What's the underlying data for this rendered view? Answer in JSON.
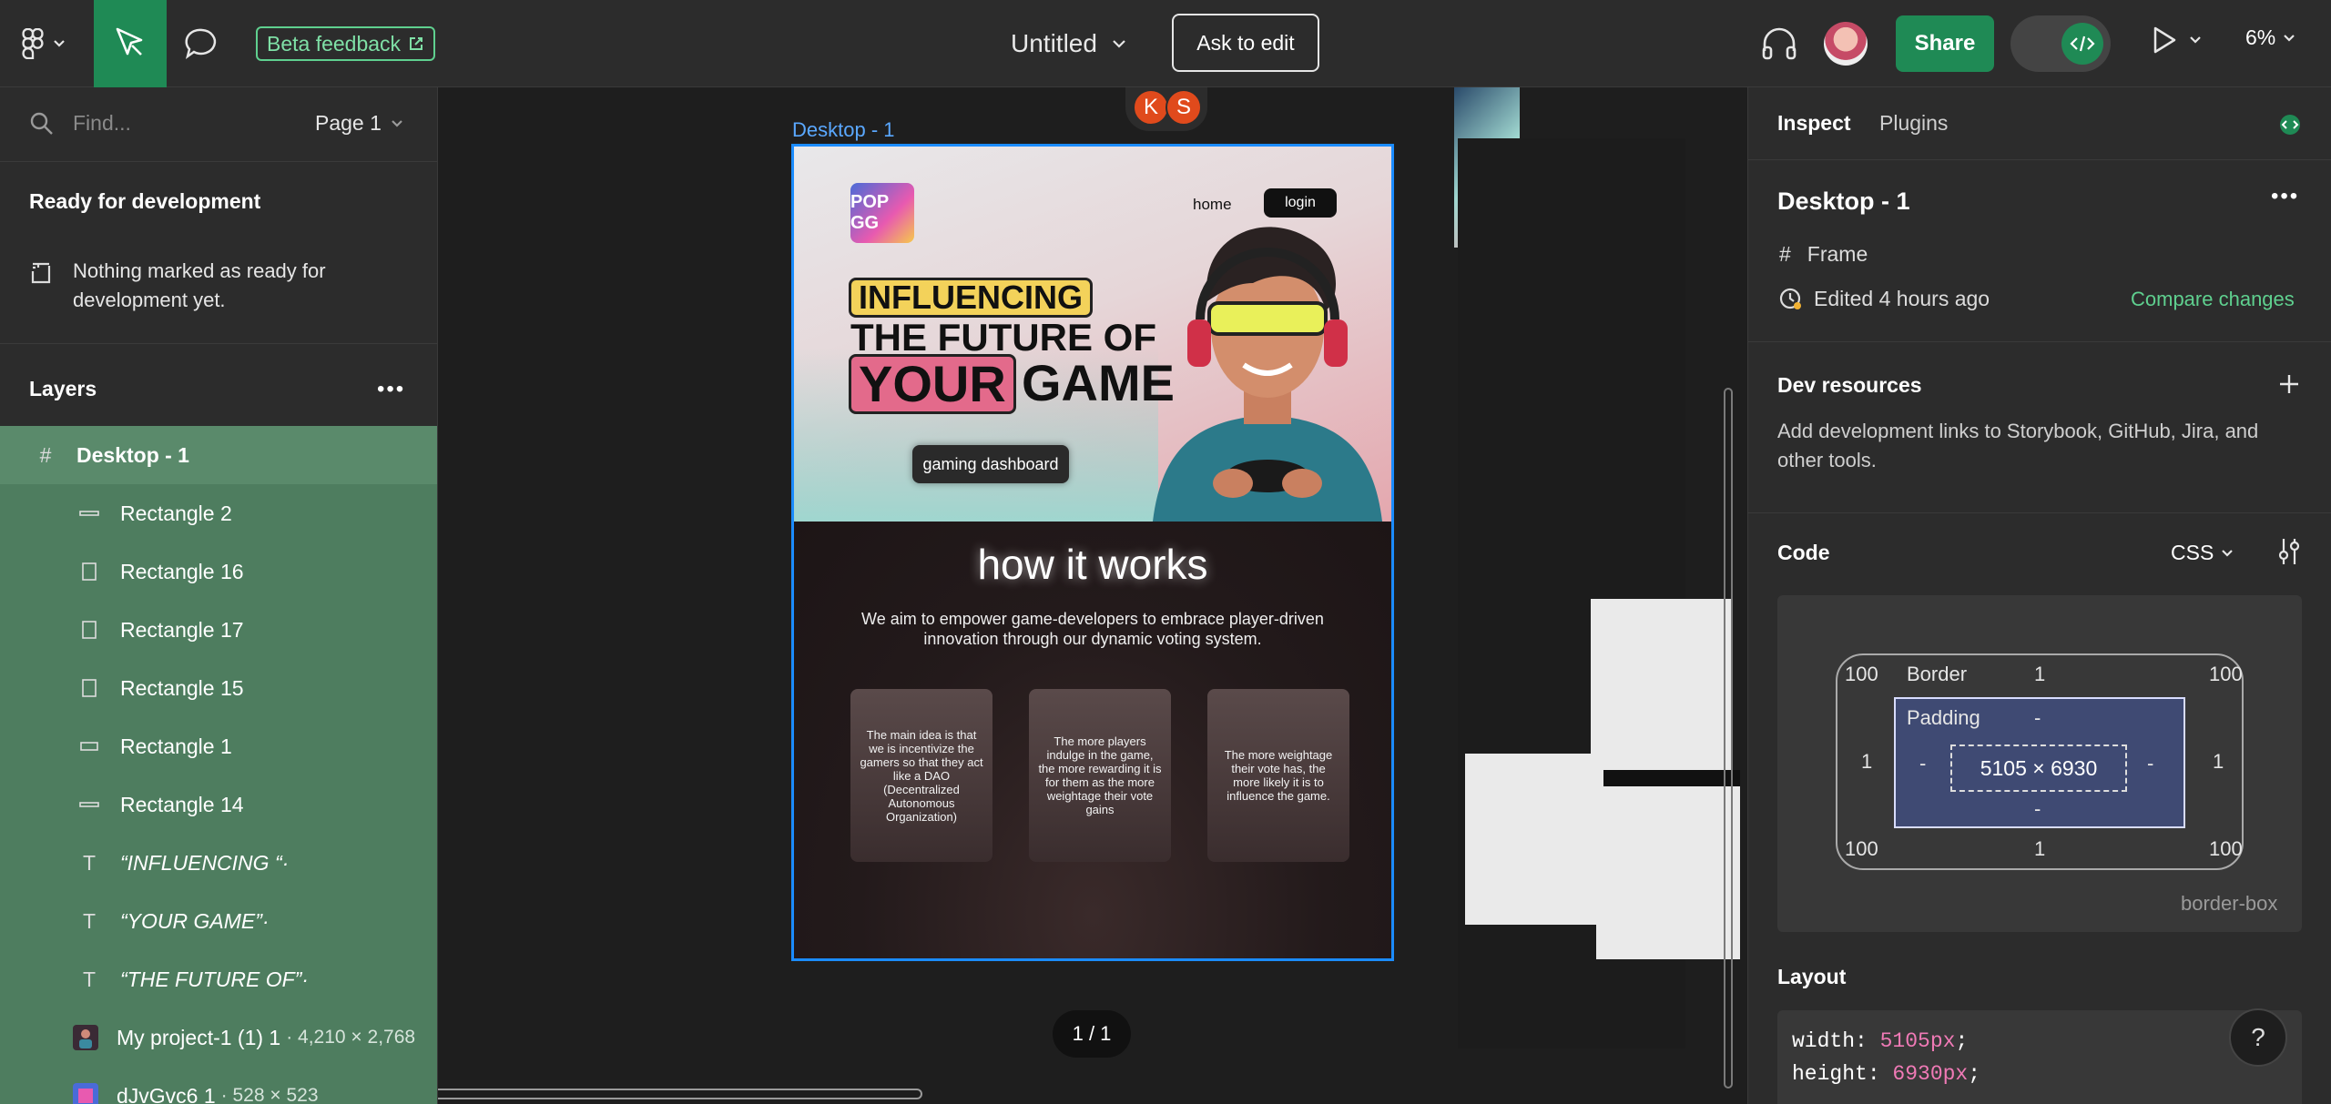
{
  "topbar": {
    "beta_label": "Beta feedback",
    "file_title": "Untitled",
    "ask_label": "Ask to edit",
    "share_label": "Share",
    "zoom": "6%"
  },
  "left": {
    "find_placeholder": "Find...",
    "page_label": "Page 1",
    "ready_title": "Ready for development",
    "ready_msg": "Nothing marked as ready for development yet.",
    "layers_title": "Layers",
    "layers": [
      {
        "name": "Desktop - 1",
        "type": "frame"
      },
      {
        "name": "Rectangle 2",
        "type": "line"
      },
      {
        "name": "Rectangle 16",
        "type": "rect"
      },
      {
        "name": "Rectangle 17",
        "type": "rect"
      },
      {
        "name": "Rectangle 15",
        "type": "rect"
      },
      {
        "name": "Rectangle 1",
        "type": "rect-thin"
      },
      {
        "name": "Rectangle 14",
        "type": "line"
      },
      {
        "name": "“INFLUENCING “·",
        "type": "text"
      },
      {
        "name": "“YOUR GAME”·",
        "type": "text"
      },
      {
        "name": "“THE FUTURE OF”·",
        "type": "text"
      },
      {
        "name": "My project-1 (1) 1",
        "dim": "· 4,210 × 2,768",
        "type": "image"
      },
      {
        "name": "dJvGvc6 1",
        "dim": "· 528 × 523",
        "type": "image"
      }
    ]
  },
  "canvas": {
    "frame_label": "Desktop - 1",
    "pager": "1 / 1",
    "chips": [
      "K",
      "S"
    ],
    "design": {
      "logo": "POP GG",
      "nav_home": "home",
      "nav_login": "login",
      "h_influencing": "INFLUENCING",
      "h_future": "THE FUTURE OF",
      "h_your": "YOUR",
      "h_game": "GAME",
      "gd_button": "gaming dashboard",
      "how_title": "how it works",
      "how_text": "We aim to empower game-developers to embrace player-driven innovation through our dynamic voting system.",
      "cards": [
        "The main idea is that we is incentivize the gamers so that they act like a DAO (Decentralized Autonomous Organization)",
        "The more players indulge in the game, the more rewarding it is for them as the more weightage their vote gains",
        "The more weightage their vote has, the more likely it is to influence the game."
      ]
    }
  },
  "right": {
    "tab_inspect": "Inspect",
    "tab_plugins": "Plugins",
    "node_title": "Desktop - 1",
    "node_type": "Frame",
    "edited": "Edited 4 hours ago",
    "compare": "Compare changes",
    "dev_title": "Dev resources",
    "dev_text": "Add development links to Storybook, GitHub, Jira, and other tools.",
    "code_title": "Code",
    "code_lang": "CSS",
    "box": {
      "margin_tl": "100",
      "margin_tr": "100",
      "margin_bl": "100",
      "margin_br": "100",
      "border_label": "Border",
      "border_top": "1",
      "border_left": "1",
      "border_right": "1",
      "border_bottom": "1",
      "padding_label": "Padding",
      "padding_top": "-",
      "padding_left": "-",
      "padding_right": "-",
      "padding_bottom": "-",
      "size": "5105 × 6930",
      "sizing": "border-box"
    },
    "layout_title": "Layout",
    "css_width_prop": "width: ",
    "css_width_val": "5105px",
    "css_height_prop": "height: ",
    "css_height_val": "6930px",
    "help": "?"
  }
}
